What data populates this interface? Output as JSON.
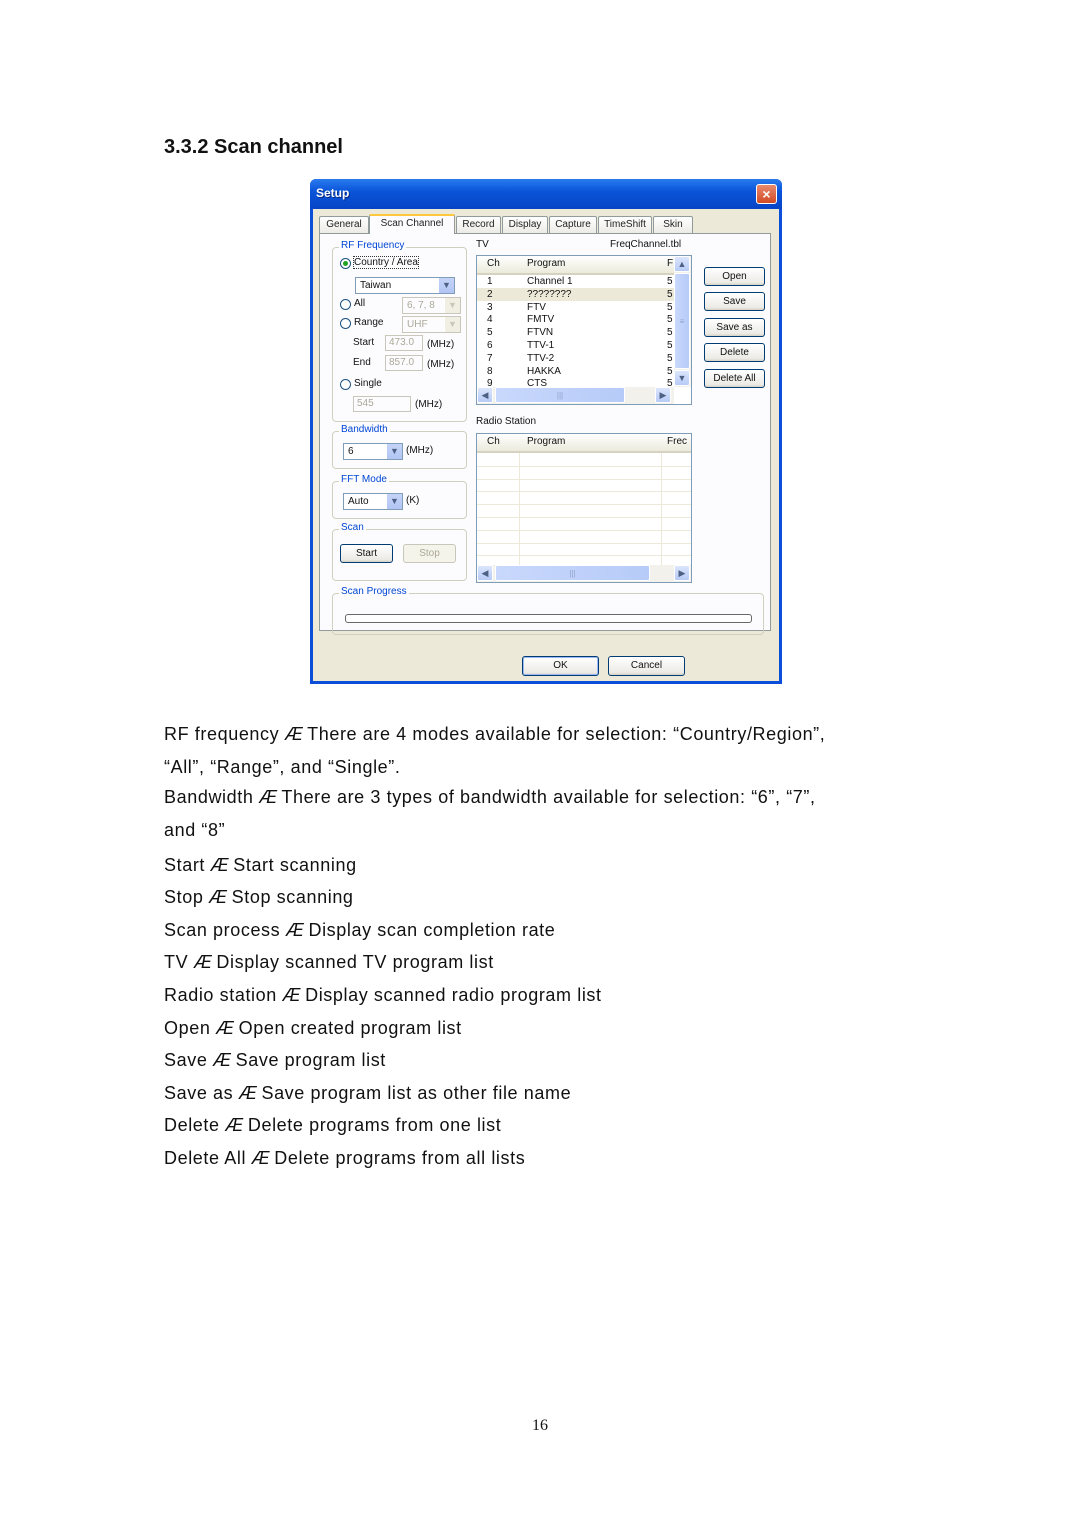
{
  "heading": "3.3.2 Scan channel",
  "dialog": {
    "title": "Setup",
    "close_icon": "×",
    "tabs": [
      "General",
      "Scan Channel",
      "Record",
      "Display",
      "Capture",
      "TimeShift",
      "Skin"
    ],
    "active_tab": "Scan Channel",
    "rf_frequency": {
      "label": "RF Frequency",
      "country_label": "Country / Area",
      "country_value": "Taiwan",
      "all_label": "All",
      "all_value": "6, 7, 8",
      "range_label": "Range",
      "range_value": "UHF",
      "start_label": "Start",
      "start_value": "473.0",
      "end_label": "End",
      "end_value": "857.0",
      "single_label": "Single",
      "single_value": "545",
      "mhz": "(MHz)",
      "selected_mode": "Country / Area"
    },
    "bandwidth": {
      "label": "Bandwidth",
      "value": "6",
      "unit": "(MHz)"
    },
    "fft_mode": {
      "label": "FFT Mode",
      "value": "Auto",
      "unit": "(K)"
    },
    "scan": {
      "label": "Scan",
      "start": "Start",
      "stop": "Stop"
    },
    "scan_progress": {
      "label": "Scan Progress",
      "value_percent": 0
    },
    "tv": {
      "label": "TV",
      "file": "FreqChannel.tbl",
      "columns": [
        "Ch",
        "Program",
        "F"
      ],
      "rows": [
        {
          "ch": "1",
          "program": "Channel 1",
          "freq": "5"
        },
        {
          "ch": "2",
          "program": "????????",
          "freq": "5"
        },
        {
          "ch": "3",
          "program": "FTV",
          "freq": "5"
        },
        {
          "ch": "4",
          "program": "FMTV",
          "freq": "5"
        },
        {
          "ch": "5",
          "program": "FTVN",
          "freq": "5"
        },
        {
          "ch": "6",
          "program": "TTV-1",
          "freq": "5"
        },
        {
          "ch": "7",
          "program": "TTV-2",
          "freq": "5"
        },
        {
          "ch": "8",
          "program": "HAKKA",
          "freq": "5"
        },
        {
          "ch": "9",
          "program": "CTS",
          "freq": "5"
        }
      ],
      "selected_row": 1
    },
    "radio": {
      "label": "Radio Station",
      "columns": [
        "Ch",
        "Program",
        "Frec"
      ]
    },
    "side_buttons": [
      "Open",
      "Save",
      "Save as",
      "Delete",
      "Delete All"
    ],
    "ok": "OK",
    "cancel": "Cancel"
  },
  "descriptions": [
    {
      "term": "RF frequency",
      "sep": "Æ",
      "text": "There are 4 modes available for selection: “Country/Region”,",
      "cont": "“All”, “Range”, and “Single”."
    },
    {
      "term": "Bandwidth",
      "sep": "Æ",
      "text": "There are 3 types of bandwidth available for selection: “6”, “7”,",
      "cont": "and “8”"
    },
    {
      "term": "Start",
      "sep": "Æ",
      "text": "Start scanning"
    },
    {
      "term": "Stop",
      "sep": "Æ",
      "text": "Stop scanning"
    },
    {
      "term": "Scan process",
      "sep": "Æ",
      "text": "Display scan completion rate"
    },
    {
      "term": "TV",
      "sep": "Æ",
      "text": "Display scanned TV program list"
    },
    {
      "term": "Radio station",
      "sep": "Æ",
      "text": "Display scanned radio program list"
    },
    {
      "term": "Open",
      "sep": "Æ",
      "text": "Open created program list"
    },
    {
      "term": "Save",
      "sep": "Æ",
      "text": "Save program list"
    },
    {
      "term": "Save as",
      "sep": "Æ",
      "text": "Save program list as other file name"
    },
    {
      "term": "Delete",
      "sep": "Æ",
      "text": "Delete programs from one list"
    },
    {
      "term": "Delete All",
      "sep": "Æ",
      "text": "Delete programs from all lists"
    }
  ],
  "page_number": "16"
}
